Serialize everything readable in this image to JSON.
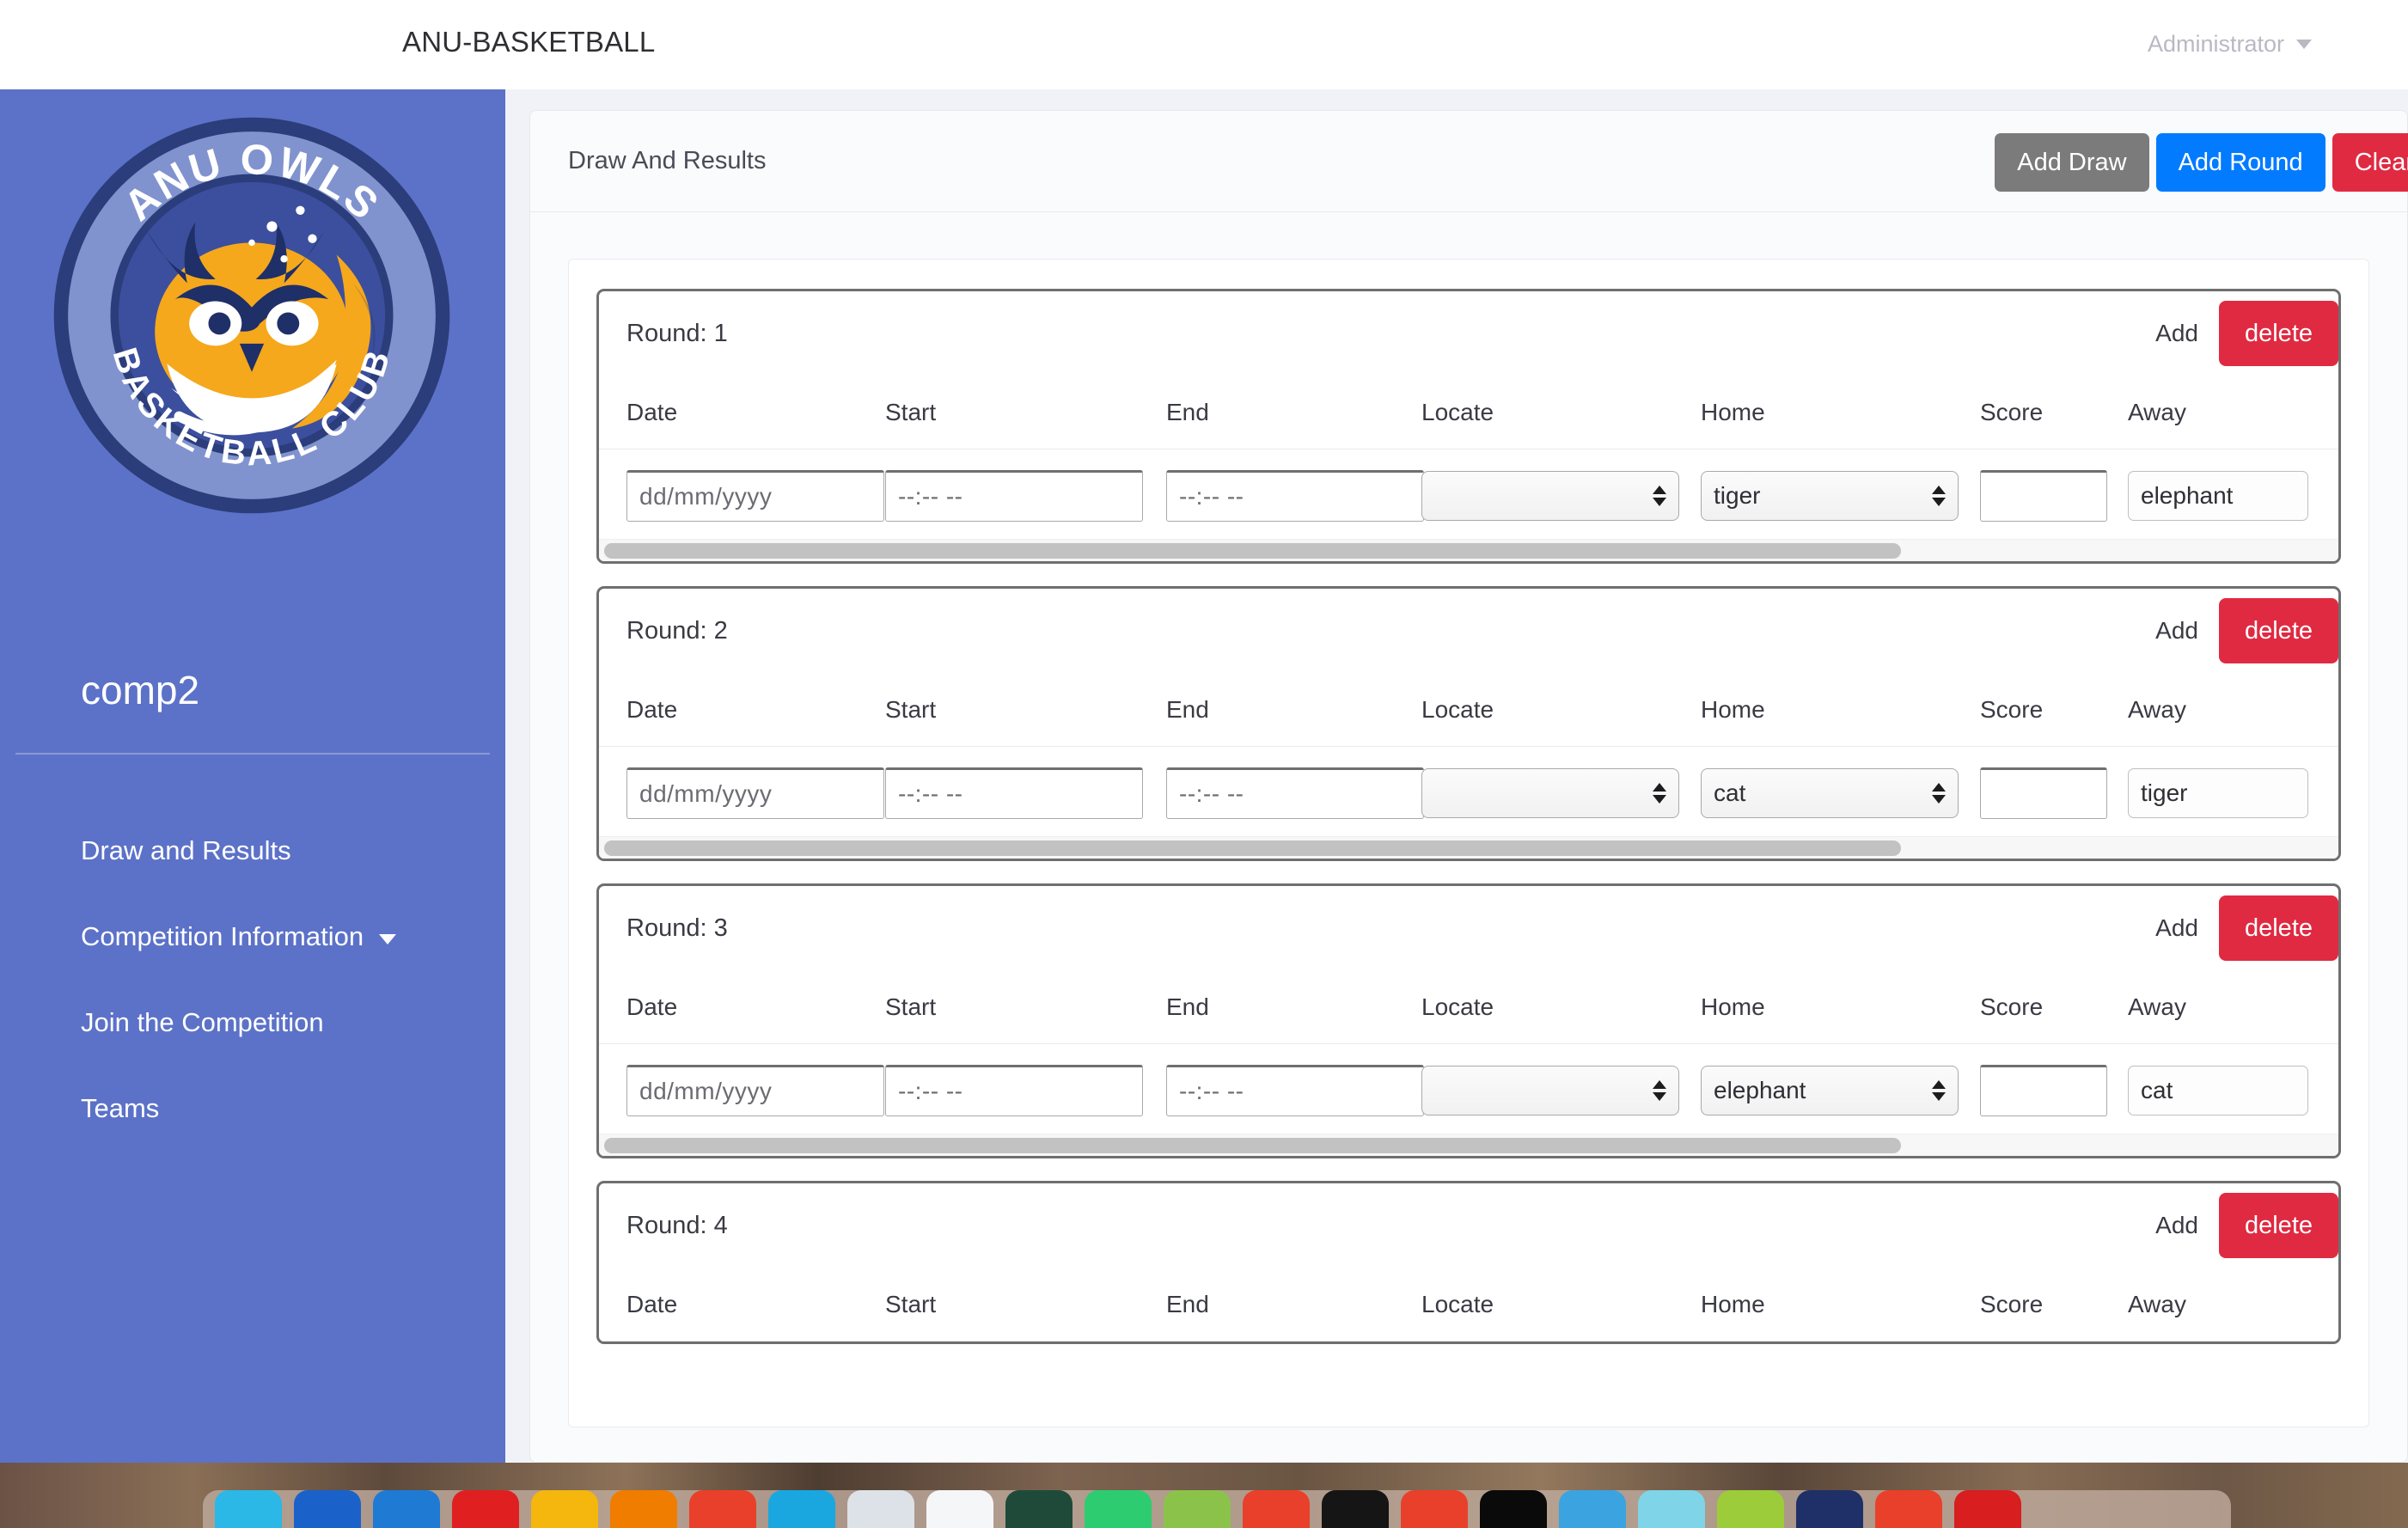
{
  "topbar": {
    "brand": "ANU-BASKETBALL",
    "user_label": "Administrator",
    "caret_icon": "chevron-down-icon"
  },
  "sidebar": {
    "logo": {
      "icon": "anu-owls-basketball-club-logo",
      "top_text": "ANU OWLS",
      "bottom_text": "BASKETBALL CLUB",
      "colors": {
        "ring_outer": "#2b3d7a",
        "ring_inner": "#8193ce",
        "disc": "#3b4f9e",
        "gold": "#f5a81c",
        "navy": "#1f2f68",
        "white": "#ffffff"
      }
    },
    "competition_name": "comp2",
    "background": "#5c72c8",
    "items": [
      {
        "label": "Draw and Results",
        "has_caret": false
      },
      {
        "label": "Competition Information",
        "has_caret": true
      },
      {
        "label": "Join the Competition",
        "has_caret": false
      },
      {
        "label": "Teams",
        "has_caret": false
      }
    ]
  },
  "panel": {
    "title": "Draw And Results",
    "buttons": [
      {
        "label": "Add Draw",
        "style": "secondary",
        "color": "#7b7b7b"
      },
      {
        "label": "Add Round",
        "style": "primary",
        "color": "#027bff"
      },
      {
        "label": "Clear",
        "style": "danger",
        "color": "#e02a42"
      }
    ]
  },
  "table": {
    "columns": [
      "Date",
      "Start",
      "End",
      "Locate",
      "Home",
      "Score",
      "Away"
    ],
    "round_label_prefix": "Round:",
    "add_label": "Add",
    "delete_label": "delete",
    "placeholders": {
      "date": "dd/mm/yyyy",
      "time": "--:-- --"
    },
    "scrollbar": {
      "thumb_percent": 75
    }
  },
  "rounds": [
    {
      "number": "1",
      "games": [
        {
          "date": "",
          "start": "",
          "end": "",
          "locate": "",
          "home": "tiger",
          "score": "",
          "away": "elephant"
        }
      ]
    },
    {
      "number": "2",
      "games": [
        {
          "date": "",
          "start": "",
          "end": "",
          "locate": "",
          "home": "cat",
          "score": "",
          "away": "tiger"
        }
      ]
    },
    {
      "number": "3",
      "games": [
        {
          "date": "",
          "start": "",
          "end": "",
          "locate": "",
          "home": "elephant",
          "score": "",
          "away": "cat"
        }
      ]
    },
    {
      "number": "4",
      "games": []
    }
  ],
  "desktop": {
    "dock_icon_colors": [
      "#2bb8e6",
      "#1a62c9",
      "#1f7ad4",
      "#e02020",
      "#f5b60d",
      "#f07c00",
      "#e8402a",
      "#1aa7e0",
      "#dde2e8",
      "#f5f6f8",
      "#1f4a3a",
      "#2ecc71",
      "#8bc34a",
      "#e8402a",
      "#151515",
      "#e8402a",
      "#0a0a0a",
      "#3ba3e0",
      "#7fd4e8",
      "#9ccc3a",
      "#1f2f68",
      "#e8402a",
      "#d81e1e"
    ]
  }
}
